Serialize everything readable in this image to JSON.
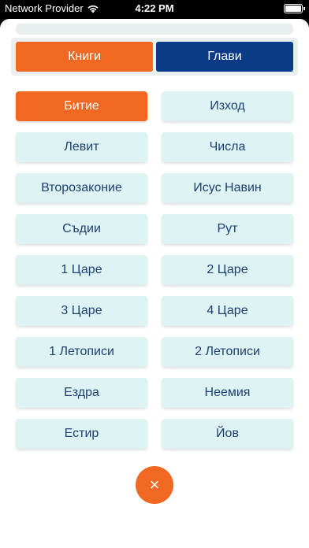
{
  "status_bar": {
    "carrier": "Network Provider",
    "time": "4:22 PM"
  },
  "tabs": {
    "books": "Книги",
    "chapters": "Глави"
  },
  "books": [
    {
      "label": "Битие",
      "active": true
    },
    {
      "label": "Изход",
      "active": false
    },
    {
      "label": "Левит",
      "active": false
    },
    {
      "label": "Числа",
      "active": false
    },
    {
      "label": "Второзаконие",
      "active": false
    },
    {
      "label": "Исус Навин",
      "active": false
    },
    {
      "label": "Съдии",
      "active": false
    },
    {
      "label": "Рут",
      "active": false
    },
    {
      "label": "1 Царе",
      "active": false
    },
    {
      "label": "2 Царе",
      "active": false
    },
    {
      "label": "3 Царе",
      "active": false
    },
    {
      "label": "4 Царе",
      "active": false
    },
    {
      "label": "1 Летописи",
      "active": false
    },
    {
      "label": "2 Летописи",
      "active": false
    },
    {
      "label": "Ездра",
      "active": false
    },
    {
      "label": "Неемия",
      "active": false
    },
    {
      "label": "Естир",
      "active": false
    },
    {
      "label": "Йов",
      "active": false
    }
  ],
  "close_icon": "×",
  "colors": {
    "accent": "#f16822",
    "navy": "#0b3a86",
    "button_bg": "#def3f3",
    "button_text": "#1d3f74"
  }
}
